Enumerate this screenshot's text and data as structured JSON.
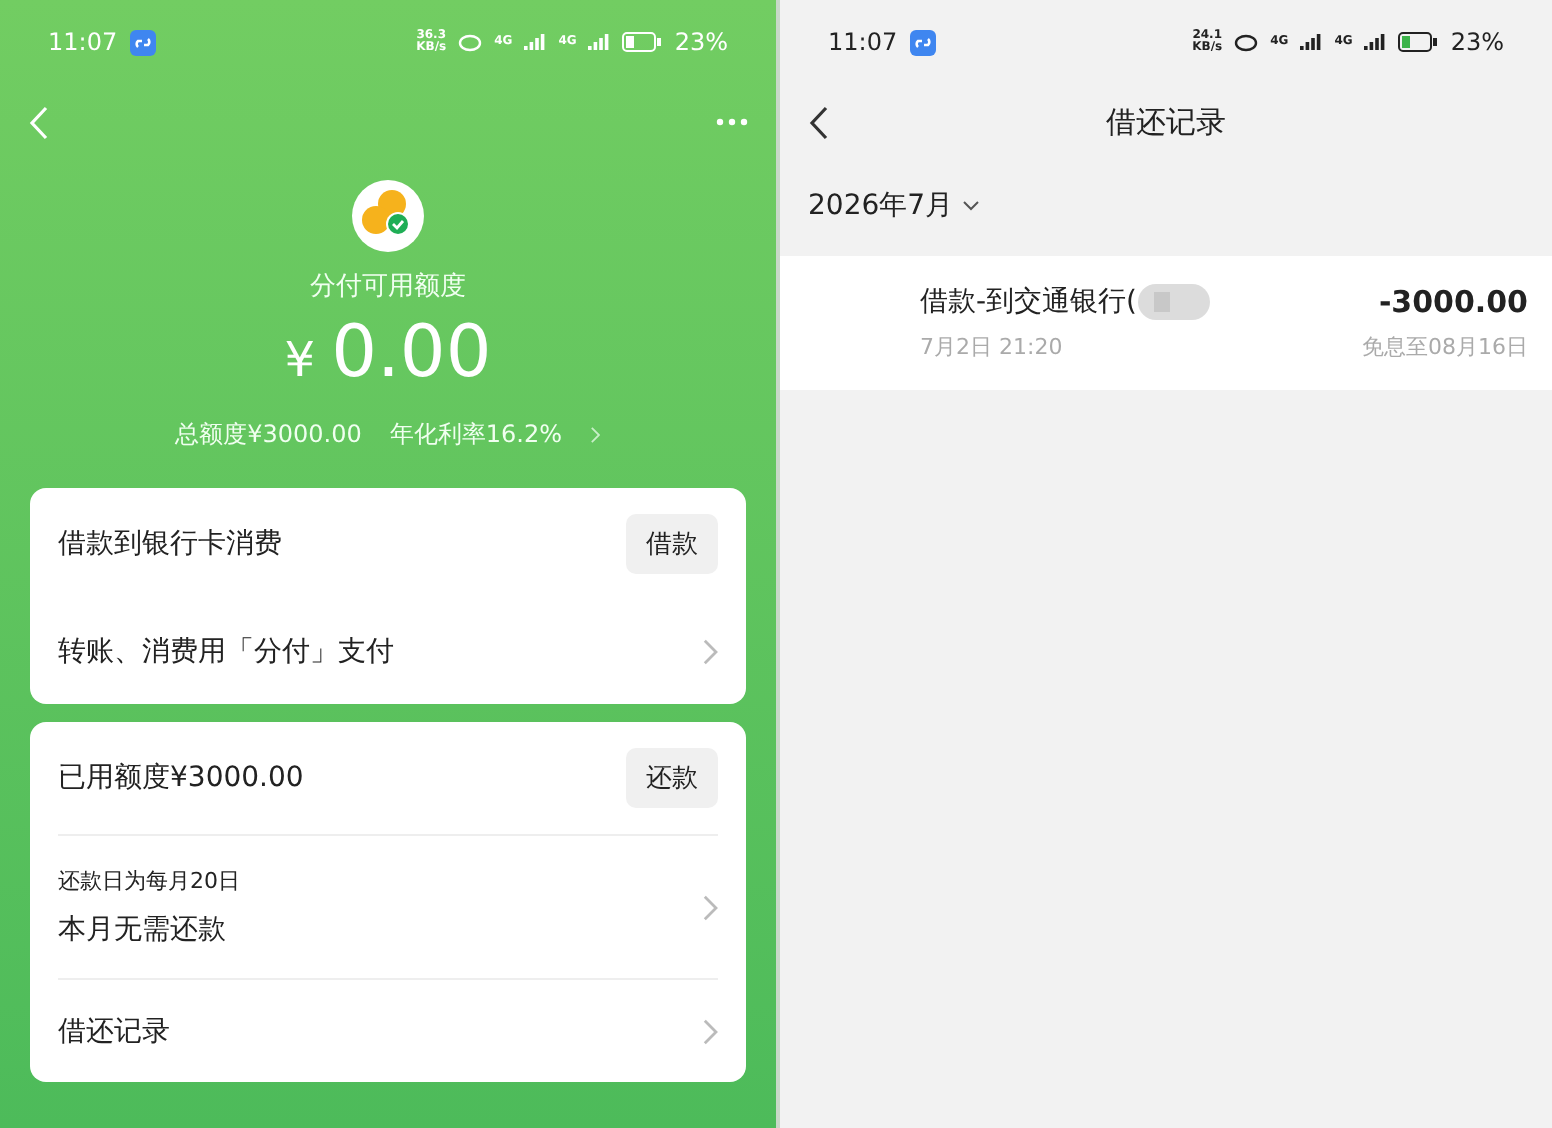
{
  "screens": [
    {
      "kind": "credit",
      "status_bar": {
        "time": "11:07",
        "speed": "36.3",
        "speed_unit": "KB/s",
        "network_1": "4G",
        "network_2": "4G",
        "battery": "23%"
      },
      "balance": {
        "label": "分付可用额度",
        "currency": "¥",
        "amount": "0.00",
        "total": "总额度¥3000.00",
        "rate": "年化利率16.2%"
      },
      "cards": [
        {
          "rows": [
            {
              "kind": "action",
              "label": "借款到银行卡消费",
              "button": "借款"
            },
            {
              "kind": "link",
              "label": "转账、消费用「分付」支付"
            }
          ]
        },
        {
          "rows": [
            {
              "kind": "action",
              "label": "已用额度¥3000.00",
              "button": "还款"
            },
            {
              "kind": "link",
              "caption": "还款日为每月20日",
              "label": "本月无需还款"
            },
            {
              "kind": "link",
              "label": "借还记录"
            }
          ]
        }
      ]
    },
    {
      "kind": "records",
      "status_bar": {
        "time": "11:07",
        "speed": "24.1",
        "speed_unit": "KB/s",
        "network_1": "4G",
        "network_2": "4G",
        "battery": "23%"
      },
      "nav": {
        "title": "借还记录"
      },
      "month": "2026年7月",
      "records": [
        {
          "title": "借款-到交通银行(",
          "amount": "-3000.00",
          "time": "7月2日 21:20",
          "note": "免息至08月16日"
        }
      ]
    }
  ]
}
